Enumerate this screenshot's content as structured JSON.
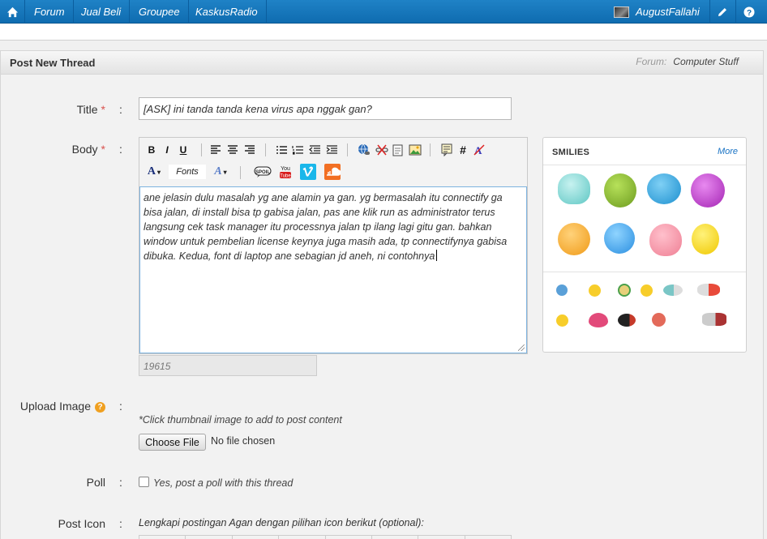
{
  "nav": {
    "items": [
      "Forum",
      "Jual Beli",
      "Groupee",
      "KaskusRadio"
    ],
    "username": "AugustFallahi"
  },
  "header": {
    "title": "Post New Thread",
    "forum_label": "Forum:",
    "forum_name": "Computer Stuff"
  },
  "form": {
    "title_label": "Title",
    "title_value": "[ASK] ini tanda tanda kena virus apa nggak gan?",
    "body_label": "Body",
    "required_mark": "*",
    "colon": ":",
    "fonts_label": "Fonts",
    "body_lines": [
      "ane jelasin dulu masalah yg ane alamin ya gan. yg bermasalah itu connectify ga",
      "bisa jalan, di install bisa tp gabisa jalan, pas ane klik run as administrator terus",
      "langsung cek task manager itu processnya jalan tp ilang lagi gitu gan. bahkan",
      "window untuk pembelian license keynya juga masih ada, tp connectifynya gabisa",
      "dibuka. Kedua, font di laptop ane sebagian jd aneh, ni contohnya"
    ],
    "char_count": "19615",
    "upload_label": "Upload Image",
    "upload_hint": "*Click thumbnail image to add to post content",
    "choose_file": "Choose File",
    "no_file": "No file chosen",
    "poll_label": "Poll",
    "poll_option": "Yes, post a poll with this thread",
    "post_icon_label": "Post Icon",
    "post_icon_text": "Lengkapi postingan Agan dengan pilihan icon berikut (optional):"
  },
  "smilies": {
    "title": "SMILIES",
    "more": "More",
    "big": [
      "scared-smiley",
      "sick-smiley",
      "gross-smiley",
      "purple-smiley",
      "angry-smiley",
      "blue-smiley",
      "heart-hug-smiley",
      "yellow-smiley"
    ],
    "small": [
      "blue-drink-smiley",
      "yellow-smile",
      "dizzy-smiley",
      "wink-smiley",
      "mask-smiley",
      "flag-smiley",
      "cry-smiley",
      "heart-smiley",
      "dark-smiley",
      "red-smiley",
      "sign-smiley"
    ]
  },
  "colors": {
    "nav_bg": "#1479be",
    "accent": "#1a73c4",
    "required": "#d9534f"
  }
}
